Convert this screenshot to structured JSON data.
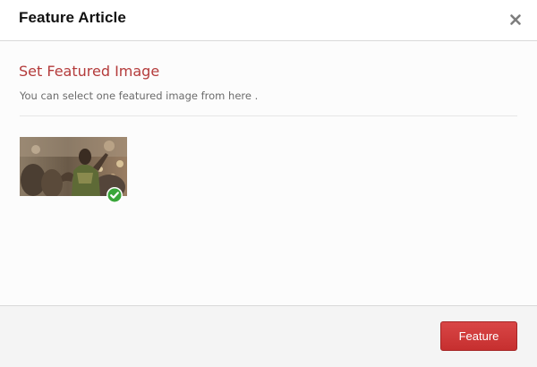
{
  "header": {
    "title": "Feature Article",
    "close_icon": "close-icon"
  },
  "body": {
    "section_title": "Set Featured Image",
    "description": "You can select one featured image from here .",
    "images": [
      {
        "selected": true,
        "badge_icon": "check-circle-icon"
      }
    ]
  },
  "footer": {
    "feature_label": "Feature"
  },
  "colors": {
    "accent_title": "#b43b3b",
    "button": "#c62f2f",
    "check": "#3aa63a"
  }
}
